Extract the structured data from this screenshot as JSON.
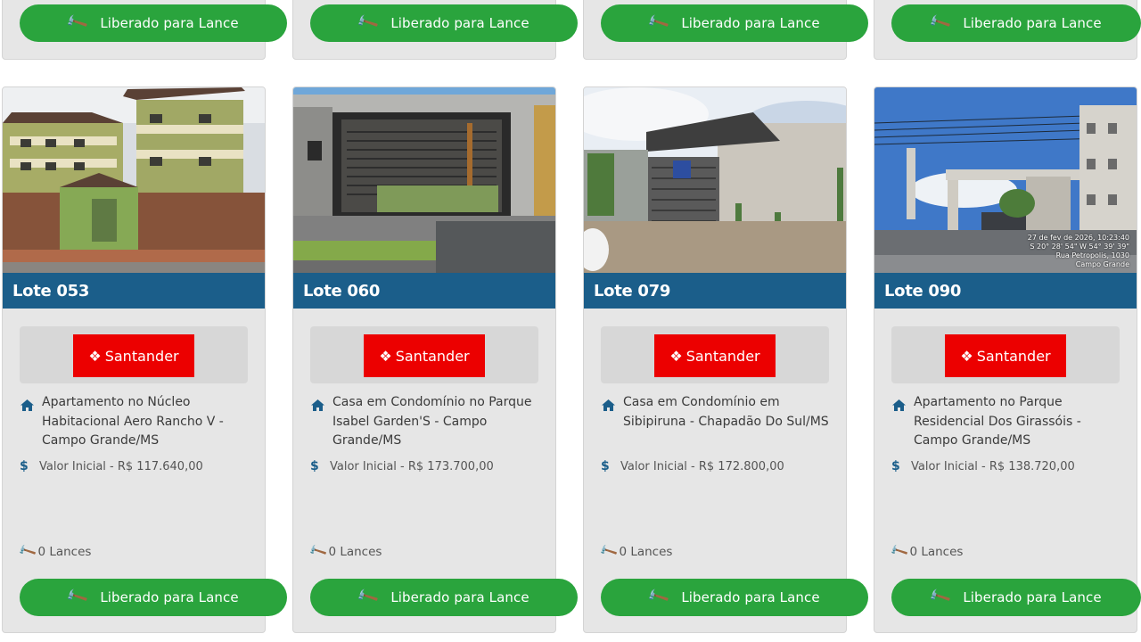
{
  "bid_button_label": "Liberado para Lance",
  "bank_logo_text": "Santander",
  "colors": {
    "bid_green": "#2aa43d",
    "lot_blue": "#1b5e8a",
    "santander_red": "#ec0000",
    "card_bg": "#e6e6e6"
  },
  "icons": {
    "button": "gavel-icon",
    "address": "home-icon",
    "price": "dollar-icon",
    "bids": "gavel-icon",
    "bank": "santander-flame-icon"
  },
  "cards": [
    {
      "lote": "Lote 053",
      "title": "Apartamento no Núcleo Habitacional Aero Rancho V - Campo Grande/MS",
      "valor": "Valor Inicial - R$ 117.640,00",
      "lances": "0 Lances"
    },
    {
      "lote": "Lote 060",
      "title": "Casa em Condomínio no Parque Isabel Garden'S - Campo Grande/MS",
      "valor": "Valor Inicial - R$ 173.700,00",
      "lances": "0 Lances"
    },
    {
      "lote": "Lote 079",
      "title": "Casa em Condomínio em Sibipiruna - Chapadão Do Sul/MS",
      "valor": "Valor Inicial - R$ 172.800,00",
      "lances": "0 Lances"
    },
    {
      "lote": "Lote 090",
      "title": "Apartamento no Parque Residencial Dos Girassóis - Campo Grande/MS",
      "valor": "Valor Inicial - R$ 138.720,00",
      "lances": "0 Lances"
    }
  ],
  "photo4_overlay": [
    "27 de fev de 2026, 10:23:40",
    "S 20° 28' 54\" W 54° 39' 39\"",
    "Rua Petropolis, 1030",
    "Campo Grande"
  ]
}
